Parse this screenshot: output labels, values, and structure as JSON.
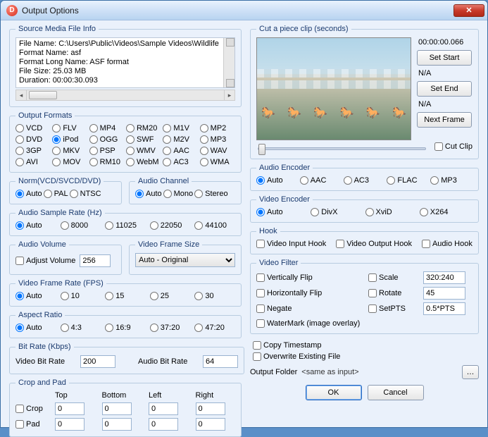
{
  "window": {
    "title": "Output Options"
  },
  "source": {
    "legend": "Source Media File Info",
    "lines": {
      "l1": "File Name: C:\\Users\\Public\\Videos\\Sample Videos\\Wildlife",
      "l2": "Format Name: asf",
      "l3": "Format Long Name: ASF format",
      "l4": "File Size: 25.03 MB",
      "l5": "Duration: 00:00:30.093"
    }
  },
  "formats": {
    "legend": "Output Formats",
    "items": [
      "VCD",
      "FLV",
      "MP4",
      "RM20",
      "M1V",
      "MP2",
      "DVD",
      "iPod",
      "OGG",
      "SWF",
      "M2V",
      "MP3",
      "3GP",
      "MKV",
      "PSP",
      "WMV",
      "AAC",
      "WAV",
      "AVI",
      "MOV",
      "RM10",
      "WebM",
      "AC3",
      "WMA"
    ],
    "selected": "iPod"
  },
  "norm": {
    "legend": "Norm(VCD/SVCD/DVD)",
    "options": [
      "Auto",
      "PAL",
      "NTSC"
    ],
    "selected": "Auto"
  },
  "audioChannel": {
    "legend": "Audio Channel",
    "options": [
      "Auto",
      "Mono",
      "Stereo"
    ],
    "selected": "Auto"
  },
  "sampleRate": {
    "legend": "Audio Sample Rate (Hz)",
    "options": [
      "Auto",
      "8000",
      "11025",
      "22050",
      "44100"
    ],
    "selected": "Auto"
  },
  "audioVolume": {
    "legend": "Audio Volume",
    "adjust": "Adjust Volume",
    "value": "256"
  },
  "frameSize": {
    "legend": "Video Frame Size",
    "value": "Auto - Original"
  },
  "fps": {
    "legend": "Video Frame Rate (FPS)",
    "options": [
      "Auto",
      "10",
      "15",
      "25",
      "30"
    ],
    "selected": "Auto"
  },
  "aspect": {
    "legend": "Aspect Ratio",
    "options": [
      "Auto",
      "4:3",
      "16:9",
      "37:20",
      "47:20"
    ],
    "selected": "Auto"
  },
  "bitrate": {
    "legend": "Bit Rate (Kbps)",
    "videoLabel": "Video Bit Rate",
    "videoValue": "200",
    "audioLabel": "Audio Bit Rate",
    "audioValue": "64"
  },
  "cropPad": {
    "legend": "Crop and Pad",
    "headers": [
      "Top",
      "Bottom",
      "Left",
      "Right"
    ],
    "cropLabel": "Crop",
    "padLabel": "Pad",
    "crop": [
      "0",
      "0",
      "0",
      "0"
    ],
    "pad": [
      "0",
      "0",
      "0",
      "0"
    ]
  },
  "cut": {
    "legend": "Cut a piece clip (seconds)",
    "time": "00:00:00.066",
    "setStart": "Set Start",
    "startVal": "N/A",
    "setEnd": "Set End",
    "endVal": "N/A",
    "nextFrame": "Next Frame",
    "cutClip": "Cut Clip"
  },
  "audioEnc": {
    "legend": "Audio Encoder",
    "options": [
      "Auto",
      "AAC",
      "AC3",
      "FLAC",
      "MP3"
    ],
    "selected": "Auto"
  },
  "videoEnc": {
    "legend": "Video Encoder",
    "options": [
      "Auto",
      "DivX",
      "XviD",
      "X264"
    ],
    "selected": "Auto"
  },
  "hook": {
    "legend": "Hook",
    "vin": "Video Input Hook",
    "vout": "Video Output Hook",
    "audio": "Audio Hook"
  },
  "videoFilter": {
    "legend": "Video Filter",
    "vflip": "Vertically Flip",
    "hflip": "Horizontally Flip",
    "negate": "Negate",
    "scale": "Scale",
    "scaleVal": "320:240",
    "rotate": "Rotate",
    "rotateVal": "45",
    "setpts": "SetPTS",
    "setptsVal": "0.5*PTS",
    "watermark": "WaterMark (image overlay)"
  },
  "misc": {
    "copyTs": "Copy Timestamp",
    "overwrite": "Overwrite Existing File",
    "outFolderLabel": "Output Folder",
    "outFolderValue": "<same as input>"
  },
  "buttons": {
    "ok": "OK",
    "cancel": "Cancel"
  }
}
